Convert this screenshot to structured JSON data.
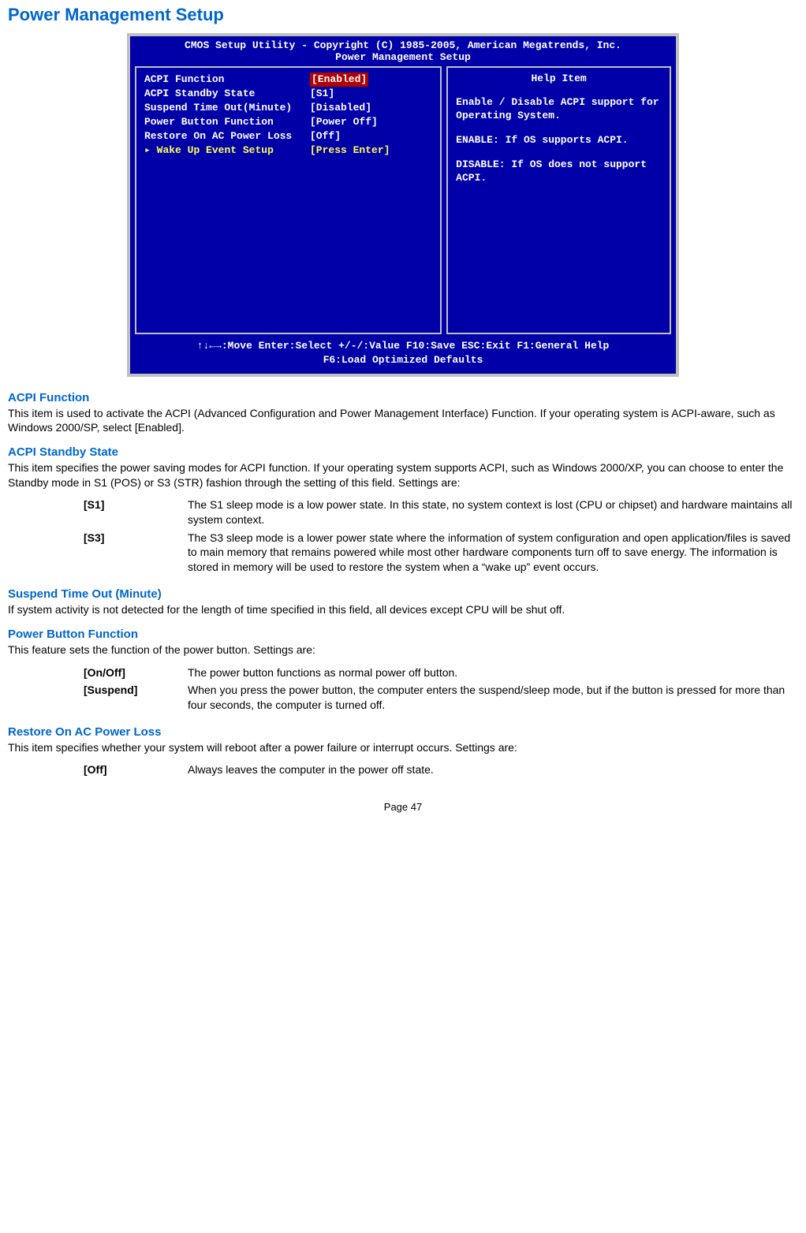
{
  "title": "Power Management Setup",
  "bios": {
    "header1": "CMOS Setup Utility - Copyright (C) 1985-2005, American Megatrends, Inc.",
    "header2": "Power Management Setup",
    "rows": [
      {
        "label": "ACPI Function",
        "value": "[Enabled]",
        "selected": true
      },
      {
        "label": "ACPI Standby State",
        "value": "[S1]"
      },
      {
        "label": "Suspend Time Out(Minute)",
        "value": "[Disabled]"
      },
      {
        "label": "Power Button Function",
        "value": "[Power Off]"
      },
      {
        "label": "Restore On AC Power Loss",
        "value": "[Off]"
      },
      {
        "label": "Wake Up Event Setup",
        "value": "[Press Enter]",
        "submenu": true,
        "yellow": true
      }
    ],
    "help_title": "Help Item",
    "help_p1": "Enable / Disable ACPI support for Operating System.",
    "help_p2": "ENABLE: If OS supports ACPI.",
    "help_p3": "DISABLE: If OS does not support ACPI.",
    "footer1": "↑↓←→:Move  Enter:Select  +/-/:Value  F10:Save  ESC:Exit  F1:General Help",
    "footer2": "F6:Load Optimized Defaults"
  },
  "sections": {
    "acpi_function": {
      "heading": "ACPI Function",
      "body": "This item is used to activate the ACPI (Advanced Configuration and Power Management Interface) Function. If your operating system is ACPI-aware, such as Windows 2000/SP, select [Enabled]."
    },
    "acpi_standby": {
      "heading": "ACPI Standby State",
      "body": "This item specifies the power saving modes for ACPI function. If your operating system supports ACPI, such as Windows 2000/XP, you can choose to enter the Standby mode in S1 (POS) or S3 (STR) fashion through the setting of this field. Settings are:",
      "settings": [
        {
          "key": "[S1]",
          "desc": "The S1 sleep mode is a low power state. In this state, no system context is lost (CPU or chipset) and hardware maintains all system context."
        },
        {
          "key": "[S3]",
          "desc": "The S3 sleep mode is a lower power state where the information of system configuration and open application/files is saved to main memory that remains powered while most other hardware components turn off to save energy. The information is stored in memory will be used to restore the system when a “wake up” event occurs."
        }
      ]
    },
    "suspend": {
      "heading": "Suspend Time Out (Minute)",
      "body": "If system activity is not detected for the length of time specified in this field, all devices except CPU will be shut off."
    },
    "power_button": {
      "heading": "Power Button Function",
      "body": "This feature sets the function of the power button. Settings are:",
      "settings": [
        {
          "key": "[On/Off]",
          "desc": "The power button functions as normal power off button."
        },
        {
          "key": "[Suspend]",
          "desc": "When you press the power button, the computer enters the suspend/sleep mode, but if the button is pressed for more than four seconds, the computer is turned off."
        }
      ]
    },
    "restore": {
      "heading": "Restore On AC Power Loss",
      "body": "This item specifies whether your system will reboot after a power failure or interrupt occurs. Settings are:",
      "settings": [
        {
          "key": "[Off]",
          "desc": "Always leaves the computer in the power off state."
        }
      ]
    }
  },
  "page_number": "Page 47"
}
